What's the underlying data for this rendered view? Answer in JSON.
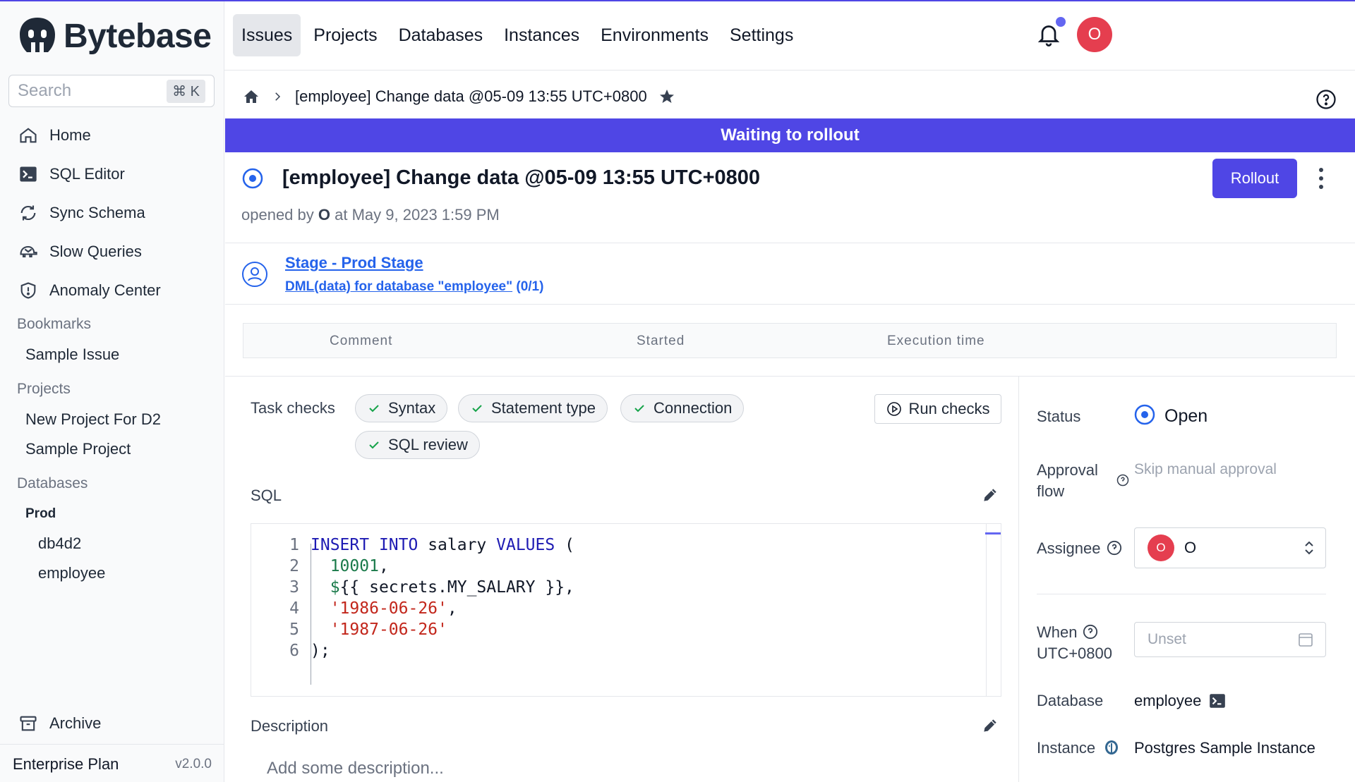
{
  "app": {
    "logo_text": "Bytebase",
    "brand_color": "#4f46e5"
  },
  "sidebar": {
    "search_placeholder": "Search",
    "search_shortcut": "⌘ K",
    "nav": [
      {
        "label": "Home",
        "icon": "home-icon"
      },
      {
        "label": "SQL Editor",
        "icon": "terminal-icon"
      },
      {
        "label": "Sync Schema",
        "icon": "sync-icon"
      },
      {
        "label": "Slow Queries",
        "icon": "turtle-icon"
      },
      {
        "label": "Anomaly Center",
        "icon": "shield-icon"
      }
    ],
    "bookmarks_title": "Bookmarks",
    "bookmarks": [
      "Sample Issue"
    ],
    "projects_title": "Projects",
    "projects": [
      "New Project For D2",
      "Sample Project"
    ],
    "databases_title": "Databases",
    "environment": "Prod",
    "databases": [
      "db4d2",
      "employee"
    ],
    "archive_label": "Archive",
    "plan": "Enterprise Plan",
    "version": "v2.0.0"
  },
  "topnav": {
    "tabs": [
      "Issues",
      "Projects",
      "Databases",
      "Instances",
      "Environments",
      "Settings"
    ],
    "active_tab": "Issues",
    "avatar_initial": "O"
  },
  "breadcrumb": {
    "current": "[employee] Change data @05-09 13:55 UTC+0800"
  },
  "banner": {
    "text": "Waiting to rollout"
  },
  "issue": {
    "title": "[employee] Change data @05-09 13:55 UTC+0800",
    "opened_prefix": "opened by",
    "opened_by": "O",
    "opened_suffix": "at May 9, 2023 1:59 PM",
    "rollout_label": "Rollout"
  },
  "stage": {
    "name": "Stage - Prod Stage",
    "task": "DML(data) for database \"employee\"",
    "task_count": "(0/1)"
  },
  "task_runs": {
    "columns": [
      "Comment",
      "Started",
      "Execution time"
    ]
  },
  "task_checks": {
    "label": "Task checks",
    "checks": [
      "Syntax",
      "Statement type",
      "Connection",
      "SQL review"
    ],
    "run_label": "Run checks"
  },
  "sql": {
    "label": "SQL",
    "lines": [
      {
        "n": "1",
        "parts": [
          [
            "kw",
            "INSERT"
          ],
          [
            "",
            " "
          ],
          [
            "kw",
            "INTO"
          ],
          [
            "",
            " salary "
          ],
          [
            "kw",
            "VALUES"
          ],
          [
            "",
            " ("
          ]
        ]
      },
      {
        "n": "2",
        "parts": [
          [
            "",
            "  "
          ],
          [
            "num",
            "10001"
          ],
          [
            "",
            ","
          ]
        ]
      },
      {
        "n": "3",
        "parts": [
          [
            "",
            "  "
          ],
          [
            "num",
            "$"
          ],
          [
            "",
            "{{ secrets.MY_SALARY }},"
          ]
        ]
      },
      {
        "n": "4",
        "parts": [
          [
            "",
            "  "
          ],
          [
            "str",
            "'1986-06-26'"
          ],
          [
            "",
            ","
          ]
        ]
      },
      {
        "n": "5",
        "parts": [
          [
            "",
            "  "
          ],
          [
            "str",
            "'1987-06-26'"
          ]
        ]
      },
      {
        "n": "6",
        "parts": [
          [
            "",
            ");"
          ]
        ]
      }
    ]
  },
  "description": {
    "label": "Description",
    "placeholder": "Add some description..."
  },
  "panel": {
    "status_label": "Status",
    "status_value": "Open",
    "approval_label_1": "Approval",
    "approval_label_2": "flow",
    "approval_value": "Skip manual approval",
    "assignee_label": "Assignee",
    "assignee_initial": "O",
    "assignee_name": "O",
    "when_label": "When",
    "when_tz": "UTC+0800",
    "when_placeholder": "Unset",
    "database_label": "Database",
    "database_value": "employee",
    "instance_label": "Instance",
    "instance_value": "Postgres Sample Instance"
  }
}
